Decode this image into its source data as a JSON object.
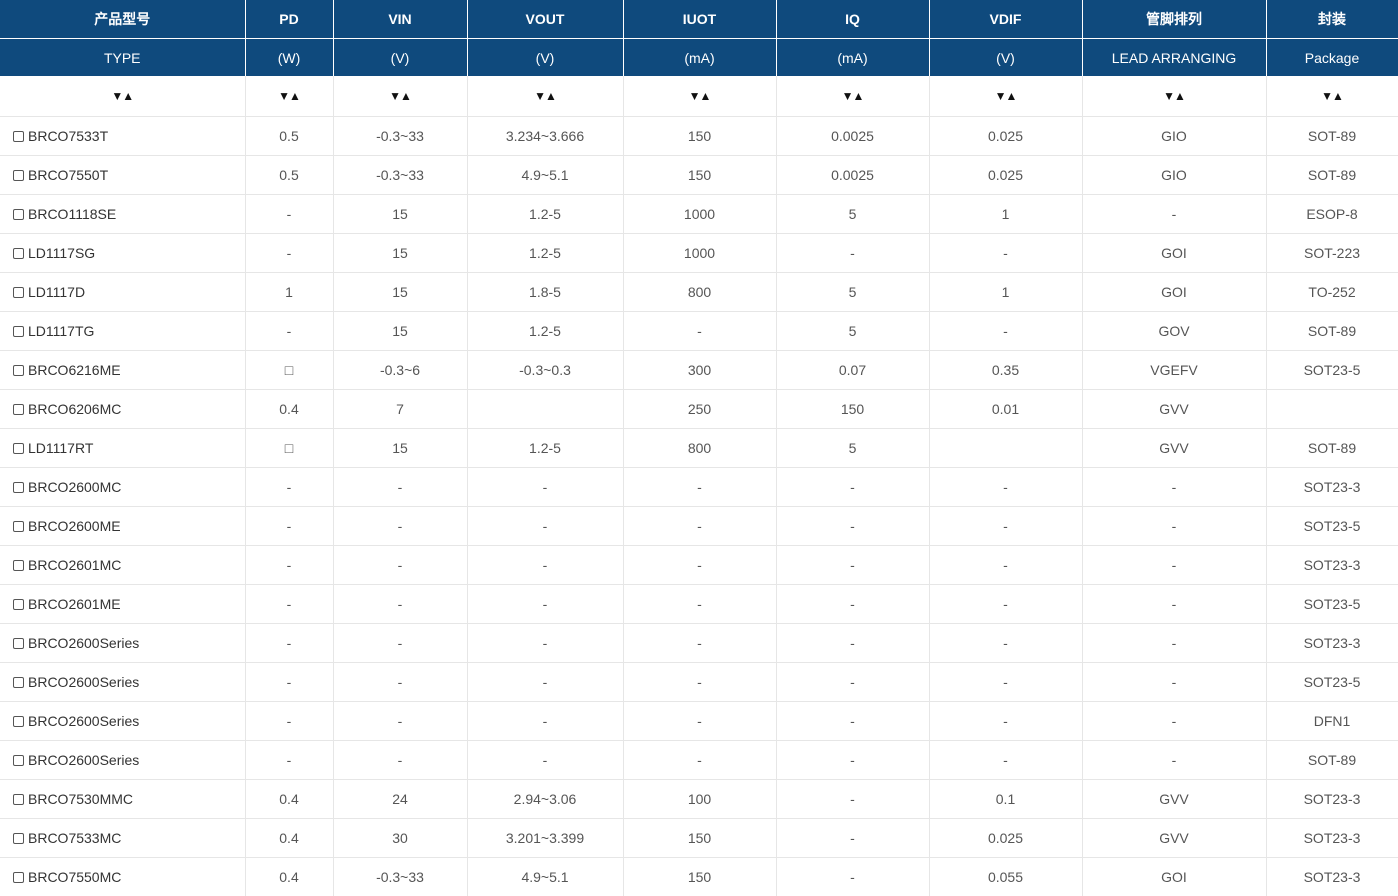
{
  "header": {
    "row1": [
      "产品型号",
      "PD",
      "VIN",
      "VOUT",
      "IUOT",
      "IQ",
      "VDIF",
      "管脚排列",
      "封装"
    ],
    "row2": [
      "TYPE",
      "(W)",
      "(V)",
      "(V)",
      "(mA)",
      "(mA)",
      "(V)",
      "LEAD ARRANGING",
      "Package"
    ]
  },
  "sort": {
    "desc_symbol": "▼",
    "asc_symbol": "▲"
  },
  "rows": [
    {
      "type": "BRCO7533T",
      "pd": "0.5",
      "vin": "-0.3~33",
      "vout": "3.234~3.666",
      "iuot": "150",
      "iq": "0.0025",
      "vdif": "0.025",
      "lead": "GIO",
      "package": "SOT-89"
    },
    {
      "type": "BRCO7550T",
      "pd": "0.5",
      "vin": "-0.3~33",
      "vout": "4.9~5.1",
      "iuot": "150",
      "iq": "0.0025",
      "vdif": "0.025",
      "lead": "GIO",
      "package": "SOT-89"
    },
    {
      "type": "BRCO1118SE",
      "pd": "-",
      "vin": "15",
      "vout": "1.2-5",
      "iuot": "1000",
      "iq": "5",
      "vdif": "1",
      "lead": "-",
      "package": "ESOP-8"
    },
    {
      "type": "LD1117SG",
      "pd": "-",
      "vin": "15",
      "vout": "1.2-5",
      "iuot": "1000",
      "iq": "-",
      "vdif": "-",
      "lead": "GOI",
      "package": "SOT-223"
    },
    {
      "type": "LD1117D",
      "pd": "1",
      "vin": "15",
      "vout": "1.8-5",
      "iuot": "800",
      "iq": "5",
      "vdif": "1",
      "lead": "GOI",
      "package": "TO-252"
    },
    {
      "type": "LD1117TG",
      "pd": "-",
      "vin": "15",
      "vout": "1.2-5",
      "iuot": "-",
      "iq": "5",
      "vdif": "-",
      "lead": "GOV",
      "package": "SOT-89"
    },
    {
      "type": "BRCO6216ME",
      "pd": "□",
      "vin": "-0.3~6",
      "vout": "-0.3~0.3",
      "iuot": "300",
      "iq": "0.07",
      "vdif": "0.35",
      "lead": "VGEFV",
      "package": "SOT23-5"
    },
    {
      "type": "BRCO6206MC",
      "pd": "0.4",
      "vin": "7",
      "vout": "",
      "iuot": "250",
      "iq": "150",
      "vdif": "0.01",
      "lead": "GVV",
      "package": ""
    },
    {
      "type": "LD1117RT",
      "pd": "□",
      "vin": "15",
      "vout": "1.2-5",
      "iuot": "800",
      "iq": "5",
      "vdif": "",
      "lead": "GVV",
      "package": "SOT-89"
    },
    {
      "type": "BRCO2600MC",
      "pd": "-",
      "vin": "-",
      "vout": "-",
      "iuot": "-",
      "iq": "-",
      "vdif": "-",
      "lead": "-",
      "package": "SOT23-3"
    },
    {
      "type": "BRCO2600ME",
      "pd": "-",
      "vin": "-",
      "vout": "-",
      "iuot": "-",
      "iq": "-",
      "vdif": "-",
      "lead": "-",
      "package": "SOT23-5"
    },
    {
      "type": "BRCO2601MC",
      "pd": "-",
      "vin": "-",
      "vout": "-",
      "iuot": "-",
      "iq": "-",
      "vdif": "-",
      "lead": "-",
      "package": "SOT23-3"
    },
    {
      "type": "BRCO2601ME",
      "pd": "-",
      "vin": "-",
      "vout": "-",
      "iuot": "-",
      "iq": "-",
      "vdif": "-",
      "lead": "-",
      "package": "SOT23-5"
    },
    {
      "type": "BRCO2600Series",
      "pd": "-",
      "vin": "-",
      "vout": "-",
      "iuot": "-",
      "iq": "-",
      "vdif": "-",
      "lead": "-",
      "package": "SOT23-3"
    },
    {
      "type": "BRCO2600Series",
      "pd": "-",
      "vin": "-",
      "vout": "-",
      "iuot": "-",
      "iq": "-",
      "vdif": "-",
      "lead": "-",
      "package": "SOT23-5"
    },
    {
      "type": "BRCO2600Series",
      "pd": "-",
      "vin": "-",
      "vout": "-",
      "iuot": "-",
      "iq": "-",
      "vdif": "-",
      "lead": "-",
      "package": "DFN1"
    },
    {
      "type": "BRCO2600Series",
      "pd": "-",
      "vin": "-",
      "vout": "-",
      "iuot": "-",
      "iq": "-",
      "vdif": "-",
      "lead": "-",
      "package": "SOT-89"
    },
    {
      "type": "BRCO7530MMC",
      "pd": "0.4",
      "vin": "24",
      "vout": "2.94~3.06",
      "iuot": "100",
      "iq": "-",
      "vdif": "0.1",
      "lead": "GVV",
      "package": "SOT23-3"
    },
    {
      "type": "BRCO7533MC",
      "pd": "0.4",
      "vin": "30",
      "vout": "3.201~3.399",
      "iuot": "150",
      "iq": "-",
      "vdif": "0.025",
      "lead": "GVV",
      "package": "SOT23-3"
    },
    {
      "type": "BRCO7550MC",
      "pd": "0.4",
      "vin": "-0.3~33",
      "vout": "4.9~5.1",
      "iuot": "150",
      "iq": "-",
      "vdif": "0.055",
      "lead": "GOI",
      "package": "SOT23-3"
    }
  ]
}
